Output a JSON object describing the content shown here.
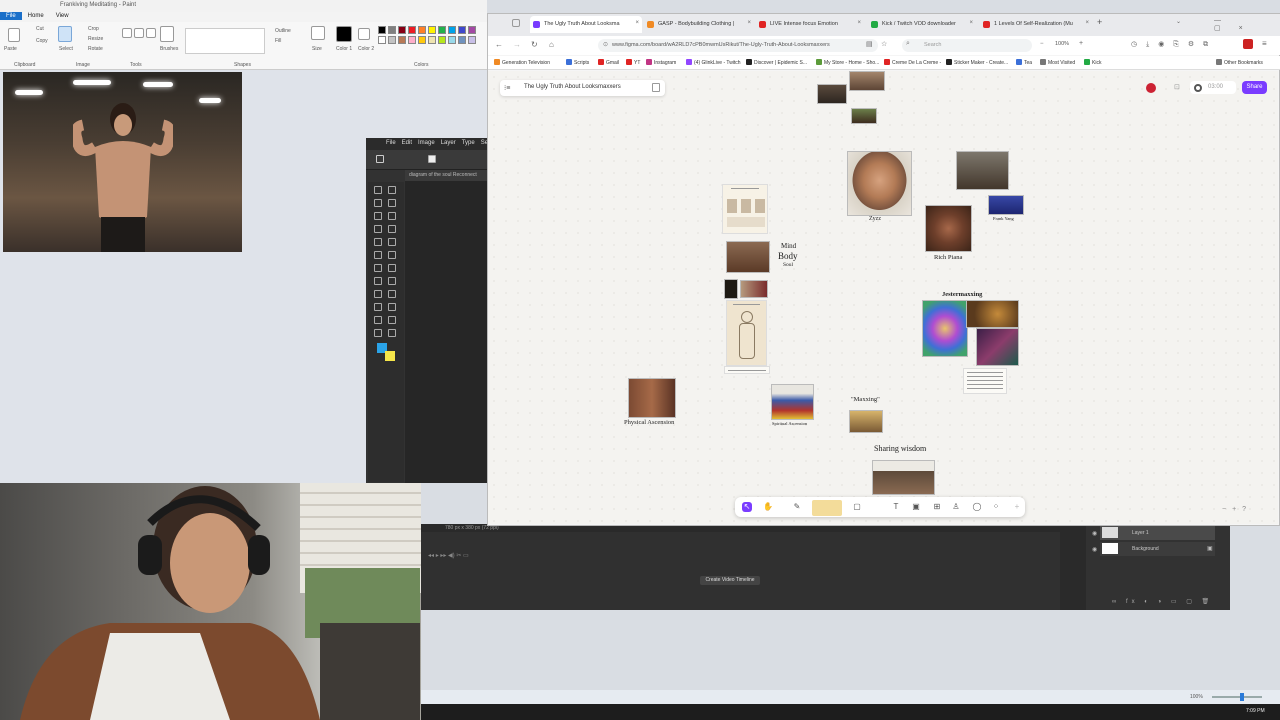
{
  "paint": {
    "title": "Frankiving Meditating - Paint",
    "menu": [
      "File",
      "Home",
      "View"
    ],
    "groups": [
      "Clipboard",
      "Image",
      "Tools",
      "Brushes",
      "Shapes",
      "Size",
      "Color 1",
      "Color 2",
      "Colors"
    ],
    "tool_labels": [
      "Paste",
      "Cut",
      "Copy",
      "Select",
      "Crop",
      "Resize",
      "Rotate",
      "Outline",
      "Fill"
    ],
    "palette": [
      "#000000",
      "#7f7f7f",
      "#880015",
      "#ed1c24",
      "#ff7f27",
      "#fff200",
      "#22b14c",
      "#00a2e8",
      "#3f48cc",
      "#a349a4",
      "#ffffff",
      "#c3c3c3",
      "#b97a57",
      "#ffaec9",
      "#ffc90e",
      "#efe4b0",
      "#b5e61d",
      "#99d9ea",
      "#7092be",
      "#c8bfe7"
    ]
  },
  "photoshop": {
    "menu": [
      "File",
      "Edit",
      "Image",
      "Layer",
      "Type",
      "Sele"
    ],
    "doc_tab": "diagram of the soul Reconnect",
    "timeline_button": "Create Video Timeline",
    "timeline_info": "780 px x 380 px (72 ppi)",
    "layers": [
      "Layer 1",
      "Background"
    ]
  },
  "browser": {
    "tabs": [
      {
        "label": "The Ugly Truth About Looksma",
        "color": "#7a3cff"
      },
      {
        "label": "GASP - Bodybuilding Clothing |",
        "color": "#f08a24"
      },
      {
        "label": "LIVE Intense focus Emotion",
        "color": "#e02424"
      },
      {
        "label": "Kick / Twitch VOD downloader",
        "color": "#22aa44"
      },
      {
        "label": "1 Levels Of Self-Realization (Mu",
        "color": "#e02424"
      }
    ],
    "url": "www.figma.com/board/wA2RLD7cPB0mwmUsRikut/The-Ugly-Truth-About-Looksmaxxers",
    "zoom": "100%",
    "search_placeholder": "Search",
    "bookmarks": [
      {
        "label": "Generation Television",
        "color": "#f08a24"
      },
      {
        "label": "Scripts",
        "color": "#3b6fd8"
      },
      {
        "label": "Gmail",
        "color": "#e02424"
      },
      {
        "label": "YT",
        "color": "#e02424"
      },
      {
        "label": "Instagram",
        "color": "#c13584"
      },
      {
        "label": "(4) GlinkLive - Twitch",
        "color": "#9146ff"
      },
      {
        "label": "Discover | Epidemic S...",
        "color": "#222222"
      },
      {
        "label": "My Store - Home - Sho...",
        "color": "#5c9b3a"
      },
      {
        "label": "Creme De La Creme -",
        "color": "#e02424"
      },
      {
        "label": "Sticker Maker - Create...",
        "color": "#222222"
      },
      {
        "label": "Tea",
        "color": "#3b6fd8"
      },
      {
        "label": "Most Visited",
        "color": "#777777"
      },
      {
        "label": "Kick",
        "color": "#22aa44"
      },
      {
        "label": "Other Bookmarks",
        "color": "#777777"
      }
    ]
  },
  "figma": {
    "board_title": "The Ugly Truth About Looksmaxxers",
    "share": "Share",
    "timer": "03:00",
    "labels": {
      "zyzz": "Zyzz",
      "frank": "Frank Yang",
      "rich": "Rich Piana",
      "jester": "Jestermaxxing",
      "mind": "Mind",
      "body": "Body",
      "soul": "Soul",
      "maxxing": "\"Maxxing\"",
      "sharing": "Sharing wisdom",
      "physical": "Physical Ascension",
      "spiritual": "Spiritual Ascension"
    }
  },
  "taskbar": {
    "clock": "7:09 PM"
  }
}
